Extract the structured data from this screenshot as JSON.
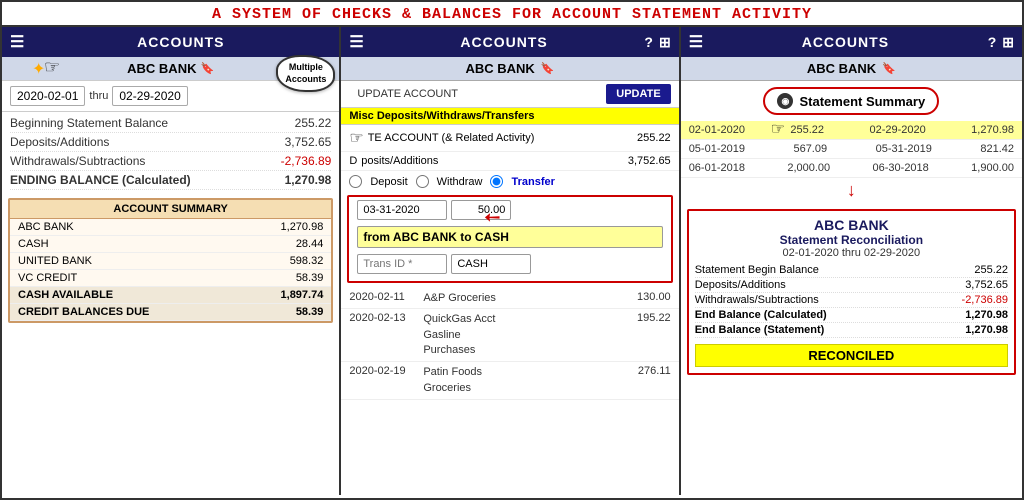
{
  "header": {
    "title": "A SYSTEM OF CHECKS & BALANCES FOR ACCOUNT STATEMENT ACTIVITY"
  },
  "panel1": {
    "topbar": {
      "title": "ACCOUNTS"
    },
    "subtitle": "ABC BANK",
    "annotation": {
      "cloud": "Multiple\nAccounts",
      "arrow_label": "→"
    },
    "date_from": "2020-02-01",
    "thru": "thru",
    "date_to": "02-29-2020",
    "summary": [
      {
        "label": "Beginning Statement Balance",
        "value": "255.22",
        "bold": false
      },
      {
        "label": "Deposits/Additions",
        "value": "3,752.65",
        "bold": false
      },
      {
        "label": "Withdrawals/Subtractions",
        "value": "-2,736.89",
        "bold": false,
        "negative": true
      },
      {
        "label": "ENDING BALANCE (Calculated)",
        "value": "1,270.98",
        "bold": true
      }
    ],
    "account_summary": {
      "title": "ACCOUNT SUMMARY",
      "accounts": [
        {
          "name": "ABC BANK",
          "value": "1,270.98"
        },
        {
          "name": "CASH",
          "value": "28.44"
        },
        {
          "name": "UNITED BANK",
          "value": "598.32"
        },
        {
          "name": "VC CREDIT",
          "value": "58.39"
        }
      ],
      "subtotals": [
        {
          "name": "CASH AVAILABLE",
          "value": "1,897.74"
        },
        {
          "name": "CREDIT BALANCES DUE",
          "value": "58.39"
        }
      ]
    }
  },
  "panel2": {
    "topbar": {
      "title": "ACCOUNTS",
      "icons": [
        "?",
        "+"
      ]
    },
    "subtitle": "ABC BANK",
    "update_account_label": "UPDATE ACCOUNT",
    "yellow_tab": "Misc Deposits/Withdraws/Transfers",
    "account_row_label": "TE ACCOUNT (& Related Activity)",
    "amount_255": "255.22",
    "deposits": "3,752.65",
    "radio_options": [
      "Deposit",
      "Withdraw",
      "Transfer"
    ],
    "selected_radio": "Transfer",
    "date_value": "03-31-2020",
    "amount_value": "50.00",
    "transfer_from": "from ABC BANK to CASH",
    "trans_id_placeholder": "Trans ID *",
    "cash_value": "CASH",
    "update_btn": "UPDATE",
    "transactions": [
      {
        "date": "2020-02-11",
        "desc": "A&P Groceries",
        "amount": "130.00"
      },
      {
        "date": "2020-02-13",
        "desc": "QuickGas Acct\nGasline\nPurchases",
        "amount": "195.22"
      },
      {
        "date": "2020-02-19",
        "desc": "Patin Foods\nGroceries",
        "amount": "276.11"
      }
    ]
  },
  "panel3": {
    "topbar": {
      "title": "ACCOUNTS",
      "icons": [
        "?",
        "+"
      ]
    },
    "subtitle": "ABC BANK",
    "stmt_summary_btn": "Statement Summary",
    "history": [
      {
        "date_from": "02-01-2020",
        "val1": "255.22",
        "date_to": "02-29-2020",
        "val2": "1,270.98",
        "highlighted": true
      },
      {
        "date_from": "05-01-2019",
        "val1": "567.09",
        "date_to": "05-31-2019",
        "val2": "821.42",
        "highlighted": false
      },
      {
        "date_from": "06-01-2018",
        "val1": "2,000.00",
        "date_to": "06-30-2018",
        "val2": "1,900.00",
        "highlighted": false
      }
    ],
    "reconcile": {
      "bank": "ABC BANK",
      "title": "Statement Reconciliation",
      "date": "02-01-2020  thru  02-29-2020",
      "rows": [
        {
          "label": "Statement Begin Balance",
          "value": "255.22",
          "bold": false,
          "negative": false
        },
        {
          "label": "Deposits/Additions",
          "value": "3,752.65",
          "bold": false,
          "negative": false
        },
        {
          "label": "Withdrawals/Subtractions",
          "value": "-2,736.89",
          "bold": false,
          "negative": true
        },
        {
          "label": "End Balance (Calculated)",
          "value": "1,270.98",
          "bold": true,
          "negative": false
        },
        {
          "label": "End Balance (Statement)",
          "value": "1,270.98",
          "bold": true,
          "negative": false
        }
      ],
      "badge": "RECONCILED"
    }
  }
}
